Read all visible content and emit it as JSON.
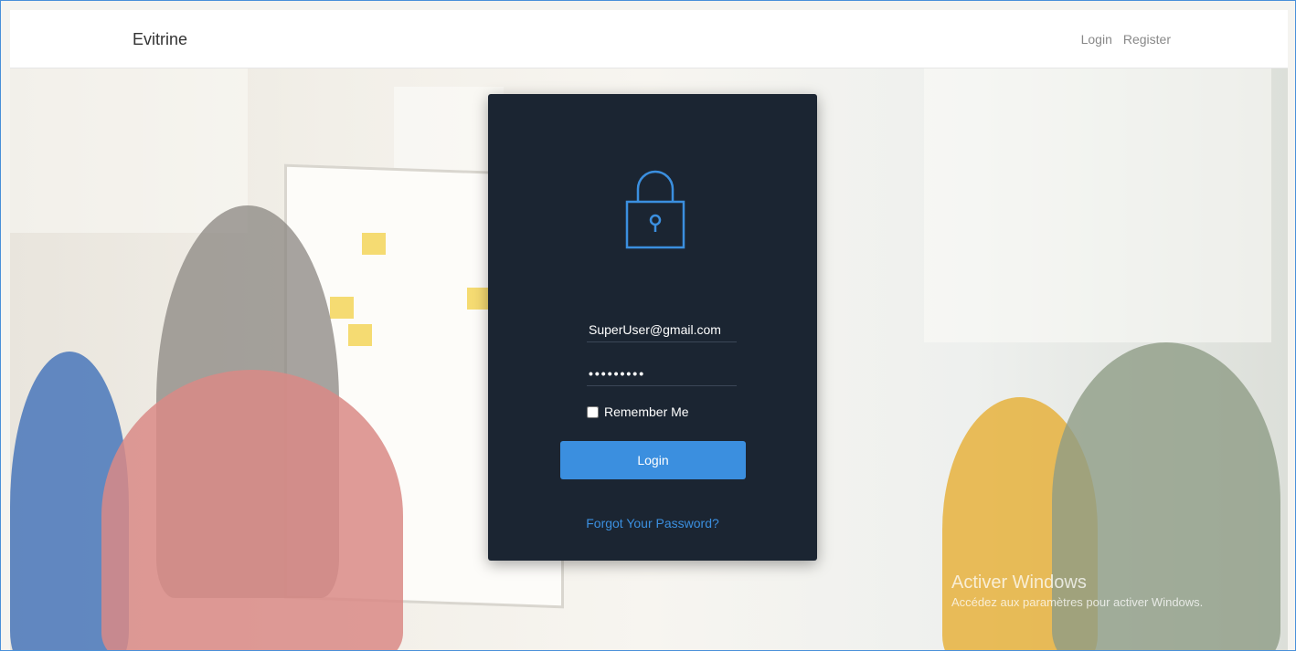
{
  "app": {
    "brand": "Evitrine"
  },
  "nav": {
    "login": "Login",
    "register": "Register"
  },
  "form": {
    "email_value": "SuperUser@gmail.com",
    "password_value": "•••••••••",
    "remember_label": "Remember Me",
    "remember_checked": false,
    "submit_label": "Login",
    "forgot_label": "Forgot Your Password?"
  },
  "watermark": {
    "title": "Activer Windows",
    "subtitle": "Accédez aux paramètres pour activer Windows."
  },
  "colors": {
    "card_bg": "#1b2532",
    "accent": "#3b8fdf",
    "navbar_bg": "#ffffff"
  },
  "icons": {
    "card": "lock-icon"
  }
}
